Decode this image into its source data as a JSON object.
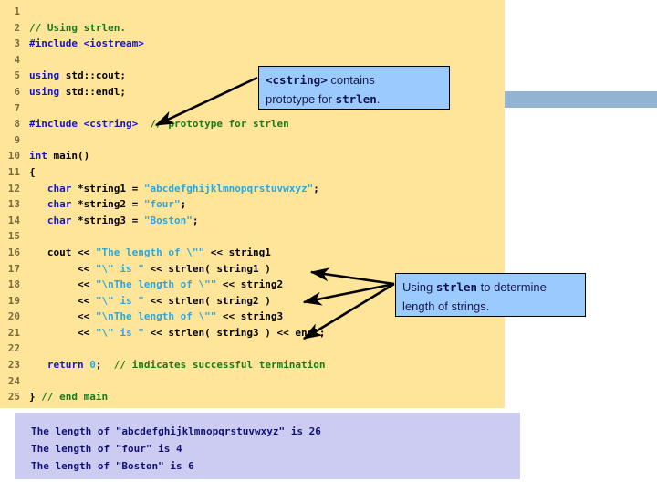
{
  "slide": {
    "code_panel": {
      "background": "#ffe599",
      "language": "cpp",
      "lines": [
        {
          "num": "1",
          "tokens": []
        },
        {
          "num": "2",
          "tokens": [
            {
              "t": "comment",
              "v": "// Using strlen."
            }
          ]
        },
        {
          "num": "3",
          "tokens": [
            {
              "t": "pre",
              "v": "#include"
            },
            {
              "t": "plain",
              "v": " "
            },
            {
              "t": "pre",
              "v": "<iostream>"
            }
          ]
        },
        {
          "num": "4",
          "tokens": []
        },
        {
          "num": "5",
          "tokens": [
            {
              "t": "keyword",
              "v": "using"
            },
            {
              "t": "plain",
              "v": " std::cout;"
            }
          ]
        },
        {
          "num": "6",
          "tokens": [
            {
              "t": "keyword",
              "v": "using"
            },
            {
              "t": "plain",
              "v": " std::endl;"
            }
          ]
        },
        {
          "num": "7",
          "tokens": []
        },
        {
          "num": "8",
          "tokens": [
            {
              "t": "pre",
              "v": "#include"
            },
            {
              "t": "plain",
              "v": " "
            },
            {
              "t": "pre",
              "v": "<cstring>"
            },
            {
              "t": "plain",
              "v": "  "
            },
            {
              "t": "comment",
              "v": "// prototype for strlen"
            }
          ]
        },
        {
          "num": "9",
          "tokens": []
        },
        {
          "num": "10",
          "tokens": [
            {
              "t": "keyword",
              "v": "int"
            },
            {
              "t": "plain",
              "v": " main()"
            }
          ]
        },
        {
          "num": "11",
          "tokens": [
            {
              "t": "plain",
              "v": "{"
            }
          ]
        },
        {
          "num": "12",
          "tokens": [
            {
              "t": "plain",
              "v": "   "
            },
            {
              "t": "keyword",
              "v": "char"
            },
            {
              "t": "plain",
              "v": " *string1 = "
            },
            {
              "t": "string",
              "v": "\"abcdefghijklmnopqrstuvwxyz\""
            },
            {
              "t": "plain",
              "v": ";"
            }
          ]
        },
        {
          "num": "13",
          "tokens": [
            {
              "t": "plain",
              "v": "   "
            },
            {
              "t": "keyword",
              "v": "char"
            },
            {
              "t": "plain",
              "v": " *string2 = "
            },
            {
              "t": "string",
              "v": "\"four\""
            },
            {
              "t": "plain",
              "v": ";"
            }
          ]
        },
        {
          "num": "14",
          "tokens": [
            {
              "t": "plain",
              "v": "   "
            },
            {
              "t": "keyword",
              "v": "char"
            },
            {
              "t": "plain",
              "v": " *string3 = "
            },
            {
              "t": "string",
              "v": "\"Boston\""
            },
            {
              "t": "plain",
              "v": ";"
            }
          ]
        },
        {
          "num": "15",
          "tokens": []
        },
        {
          "num": "16",
          "tokens": [
            {
              "t": "plain",
              "v": "   cout << "
            },
            {
              "t": "string",
              "v": "\"The length of \\\"\""
            },
            {
              "t": "plain",
              "v": " << string1"
            }
          ]
        },
        {
          "num": "17",
          "tokens": [
            {
              "t": "plain",
              "v": "        << "
            },
            {
              "t": "string",
              "v": "\"\\\" is \""
            },
            {
              "t": "plain",
              "v": " << strlen( string1 )"
            }
          ]
        },
        {
          "num": "18",
          "tokens": [
            {
              "t": "plain",
              "v": "        << "
            },
            {
              "t": "string",
              "v": "\"\\nThe length of \\\"\""
            },
            {
              "t": "plain",
              "v": " << string2"
            }
          ]
        },
        {
          "num": "19",
          "tokens": [
            {
              "t": "plain",
              "v": "        << "
            },
            {
              "t": "string",
              "v": "\"\\\" is \""
            },
            {
              "t": "plain",
              "v": " << strlen( string2 )"
            }
          ]
        },
        {
          "num": "20",
          "tokens": [
            {
              "t": "plain",
              "v": "        << "
            },
            {
              "t": "string",
              "v": "\"\\nThe length of \\\"\""
            },
            {
              "t": "plain",
              "v": " << string3"
            }
          ]
        },
        {
          "num": "21",
          "tokens": [
            {
              "t": "plain",
              "v": "        << "
            },
            {
              "t": "string",
              "v": "\"\\\" is \""
            },
            {
              "t": "plain",
              "v": " << strlen( string3 ) << endl;"
            }
          ]
        },
        {
          "num": "22",
          "tokens": []
        },
        {
          "num": "23",
          "tokens": [
            {
              "t": "plain",
              "v": "   "
            },
            {
              "t": "keyword",
              "v": "return"
            },
            {
              "t": "plain",
              "v": " "
            },
            {
              "t": "number",
              "v": "0"
            },
            {
              "t": "plain",
              "v": ";  "
            },
            {
              "t": "comment",
              "v": "// indicates successful termination"
            }
          ]
        },
        {
          "num": "24",
          "tokens": []
        },
        {
          "num": "25",
          "tokens": [
            {
              "t": "plain",
              "v": "} "
            },
            {
              "t": "comment",
              "v": "// end main"
            }
          ]
        }
      ]
    },
    "output_panel": {
      "background": "#ccccf2",
      "lines": [
        "The length of \"abcdefghijklmnopqrstuvwxyz\" is 26",
        "The length of \"four\" is 4",
        "The length of \"Boston\" is 6"
      ]
    },
    "callouts": [
      {
        "id": "cstring",
        "parts": [
          {
            "code": true,
            "v": "<cstring>"
          },
          {
            "code": false,
            "v": " contains"
          },
          {
            "br": true
          },
          {
            "code": false,
            "v": "prototype for "
          },
          {
            "code": true,
            "v": "strlen"
          },
          {
            "code": false,
            "v": "."
          }
        ],
        "background": "#9bcaff",
        "border": "#000000"
      },
      {
        "id": "strlen",
        "parts": [
          {
            "code": false,
            "v": "Using "
          },
          {
            "code": true,
            "v": "strlen"
          },
          {
            "code": false,
            "v": " to determine"
          },
          {
            "br": true
          },
          {
            "code": false,
            "v": "length of strings."
          }
        ],
        "background": "#9bcaff",
        "border": "#000000"
      }
    ],
    "decor_bar": {
      "color": "#93b3d2"
    },
    "colors": {
      "code_background": "#ffe599",
      "comment": "#1a7a1a",
      "keyword": "#1414cc",
      "preprocessor": "#1414cc",
      "string": "#29a7e0",
      "plain": "#000000",
      "line_number": "#7a6a3a",
      "output_text": "#10107a"
    }
  }
}
